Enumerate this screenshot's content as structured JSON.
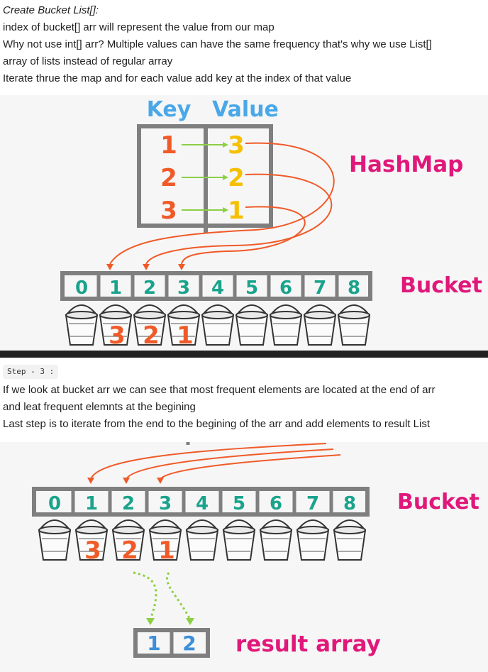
{
  "part1": {
    "heading": "Create Bucket List[]:",
    "lines": [
      "index of bucket[] arr will represent the value from our map",
      "Why not use int[] arr? Multiple values can have the same frequency that's why we use List[]",
      "array of lists instead of regular array",
      "Iterate thrue the map and for each value add key at the index of that value"
    ]
  },
  "diagram1": {
    "key_header": "Key",
    "value_header": "Value",
    "keys": [
      "1",
      "2",
      "3"
    ],
    "values": [
      "3",
      "2",
      "1"
    ],
    "hashmap_label": "HashMap",
    "bucket_label": "Bucket",
    "bucket_indices": [
      "0",
      "1",
      "2",
      "3",
      "4",
      "5",
      "6",
      "7",
      "8"
    ],
    "bucket_contents": {
      "1": "3",
      "2": "2",
      "3": "1"
    }
  },
  "part2": {
    "step_badge": "Step - 3 :",
    "lines": [
      "If we look at bucket arr we can see that most frequent elements are located at the end of arr",
      "and leat frequent elemnts at the begining",
      "Last step is to iterate from the end to the begining of the arr and add elements to result List"
    ]
  },
  "diagram2": {
    "bucket_label": "Bucket",
    "bucket_indices": [
      "0",
      "1",
      "2",
      "3",
      "4",
      "5",
      "6",
      "7",
      "8"
    ],
    "bucket_contents": {
      "1": "3",
      "2": "2",
      "3": "1"
    },
    "result_values": [
      "1",
      "2"
    ],
    "result_label": "result array"
  },
  "colors": {
    "key_blue": "#4aa8e8",
    "orange": "#f05a28",
    "yellow": "#f5c000",
    "magenta": "#e0187a",
    "teal": "#1aa38c",
    "green": "#8dcf45",
    "grid_gray": "#7f7f7f",
    "result_blue": "#3c8fd8"
  }
}
